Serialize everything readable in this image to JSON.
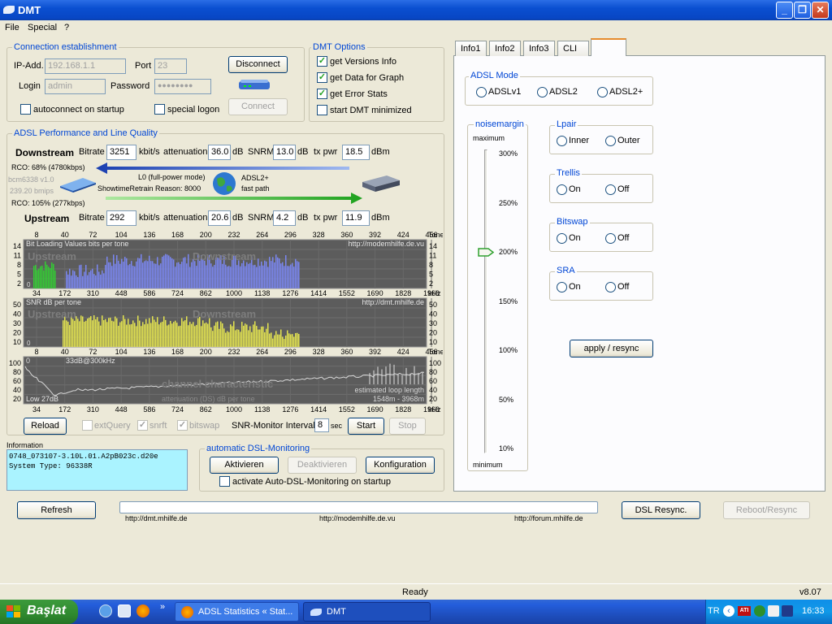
{
  "window": {
    "title": "DMT",
    "min": "_",
    "max": "❐",
    "close": "✕"
  },
  "menu": [
    "File",
    "Special",
    "?"
  ],
  "conn": {
    "title": "Connection establishment",
    "ip_label": "IP-Add.",
    "ip": "192.168.1.1",
    "port_label": "Port",
    "port": "23",
    "login_label": "Login",
    "login": "admin",
    "pw_label": "Password",
    "pw": "●●●●●●●●",
    "disconnect": "Disconnect",
    "connect": "Connect",
    "autoconnect": "autoconnect on startup",
    "special": "special logon"
  },
  "opts": {
    "title": "DMT Options",
    "items": [
      {
        "label": "get Versions Info",
        "checked": true
      },
      {
        "label": "get Data for Graph",
        "checked": true
      },
      {
        "label": "get Error Stats",
        "checked": true
      },
      {
        "label": "start DMT minimized",
        "checked": false
      }
    ]
  },
  "perf": {
    "title": "ADSL Performance and Line Quality",
    "down": {
      "label": "Downstream",
      "bitrate_label": "Bitrate",
      "bitrate": "3251",
      "unit": "kbit/s",
      "att_label": "attenuation",
      "att": "36.0",
      "db": "dB",
      "snrm_label": "SNRM",
      "snrm": "13.0",
      "tx_label": "tx pwr",
      "tx": "18.5",
      "dbm": "dBm",
      "rco": "RCO: 68% (4780kbps)"
    },
    "up": {
      "label": "Upstream",
      "bitrate_label": "Bitrate",
      "bitrate": "292",
      "unit": "kbit/s",
      "att_label": "attenuation",
      "att": "20.6",
      "db": "dB",
      "snrm_label": "SNRM",
      "snrm": "4.2",
      "tx_label": "tx pwr",
      "tx": "11.9",
      "dbm": "dBm",
      "rco": "RCO: 105% (277kbps)"
    },
    "chip": "bcm6338 v1.0",
    "bmips": "239.20 bmips",
    "mode": "L0 (full-power mode)",
    "showtime": "ShowtimeRetrain Reason: 8000",
    "adsl": "ADSL2+",
    "path": "fast path"
  },
  "charts": {
    "tone_ticks": [
      "8",
      "40",
      "72",
      "104",
      "136",
      "168",
      "200",
      "232",
      "264",
      "296",
      "328",
      "360",
      "392",
      "424",
      "456"
    ],
    "tone_label": "Tone",
    "khz_ticks": [
      "34",
      "172",
      "310",
      "448",
      "586",
      "724",
      "862",
      "1000",
      "1138",
      "1276",
      "1414",
      "1552",
      "1690",
      "1828",
      "1966"
    ],
    "khz_label": "kHz",
    "bits": {
      "title": "Bit Loading Values   bits per tone",
      "url": "http://modemhilfe.de.vu",
      "wm_up": "Upstream",
      "wm_down": "Downstream",
      "yticks": [
        "14",
        "11",
        "8",
        "5",
        "2"
      ],
      "zero": "0"
    },
    "snr": {
      "title": "SNR  dB per tone",
      "url": "http://dmt.mhilfe.de",
      "wm_up": "Upstream",
      "wm_down": "Downstream",
      "yticks": [
        "50",
        "40",
        "30",
        "20",
        "10"
      ],
      "zero": "0"
    },
    "chan": {
      "title": "33dB@300kHz",
      "yticks": [
        "100",
        "80",
        "60",
        "40",
        "20"
      ],
      "low": "Low 27dB",
      "wm": "channel characteristic",
      "sub": "attenuation (DS)  dB per tone",
      "est": "estimated loop length",
      "len": "1548m - 3968m",
      "zero": "0"
    }
  },
  "controls": {
    "reload": "Reload",
    "extquery": "extQuery",
    "snrft": "snrft",
    "bitswap": "bitswap",
    "interval_label": "SNR-Monitor Interval:",
    "interval": "8",
    "sec": "sec",
    "start": "Start",
    "stop": "Stop"
  },
  "info": {
    "title": "Information",
    "lines": [
      "0748_073107-3.10L.01.A2pB023c.d20e",
      "System Type: 96338R"
    ]
  },
  "auto": {
    "title": "automatic DSL-Monitoring",
    "activate": "Aktivieren",
    "deactivate": "Deaktivieren",
    "config": "Konfiguration",
    "startup": "activate Auto-DSL-Monitoring on startup"
  },
  "bottom": {
    "refresh": "Refresh",
    "link1": "http://dmt.mhilfe.de",
    "link2": "http://modemhilfe.de.vu",
    "link3": "http://forum.mhilfe.de",
    "resync": "DSL Resync.",
    "reboot": "Reboot/Resync"
  },
  "tabs": [
    "Info1",
    "Info2",
    "Info3",
    "CLI",
    ""
  ],
  "adsl_mode": {
    "title": "ADSL Mode",
    "options": [
      "ADSLv1",
      "ADSL2",
      "ADSL2+"
    ]
  },
  "noise": {
    "title": "noisemargin",
    "max": "maximum",
    "min": "minimum",
    "ticks": [
      "300%",
      "250%",
      "200%",
      "150%",
      "100%",
      "50%",
      "10%"
    ],
    "value_pct": 200
  },
  "lpair": {
    "title": "Lpair",
    "options": [
      "Inner",
      "Outer"
    ]
  },
  "trellis": {
    "title": "Trellis",
    "options": [
      "On",
      "Off"
    ]
  },
  "bitswap_grp": {
    "title": "Bitswap",
    "options": [
      "On",
      "Off"
    ]
  },
  "sra": {
    "title": "SRA",
    "options": [
      "On",
      "Off"
    ]
  },
  "apply": "apply / resync",
  "status": {
    "text": "Ready",
    "version": "v8.07"
  },
  "taskbar": {
    "start": "Başlat",
    "task1": "ADSL Statistics « Stat...",
    "task2": "DMT",
    "lang": "TR",
    "clock": "16:33"
  }
}
